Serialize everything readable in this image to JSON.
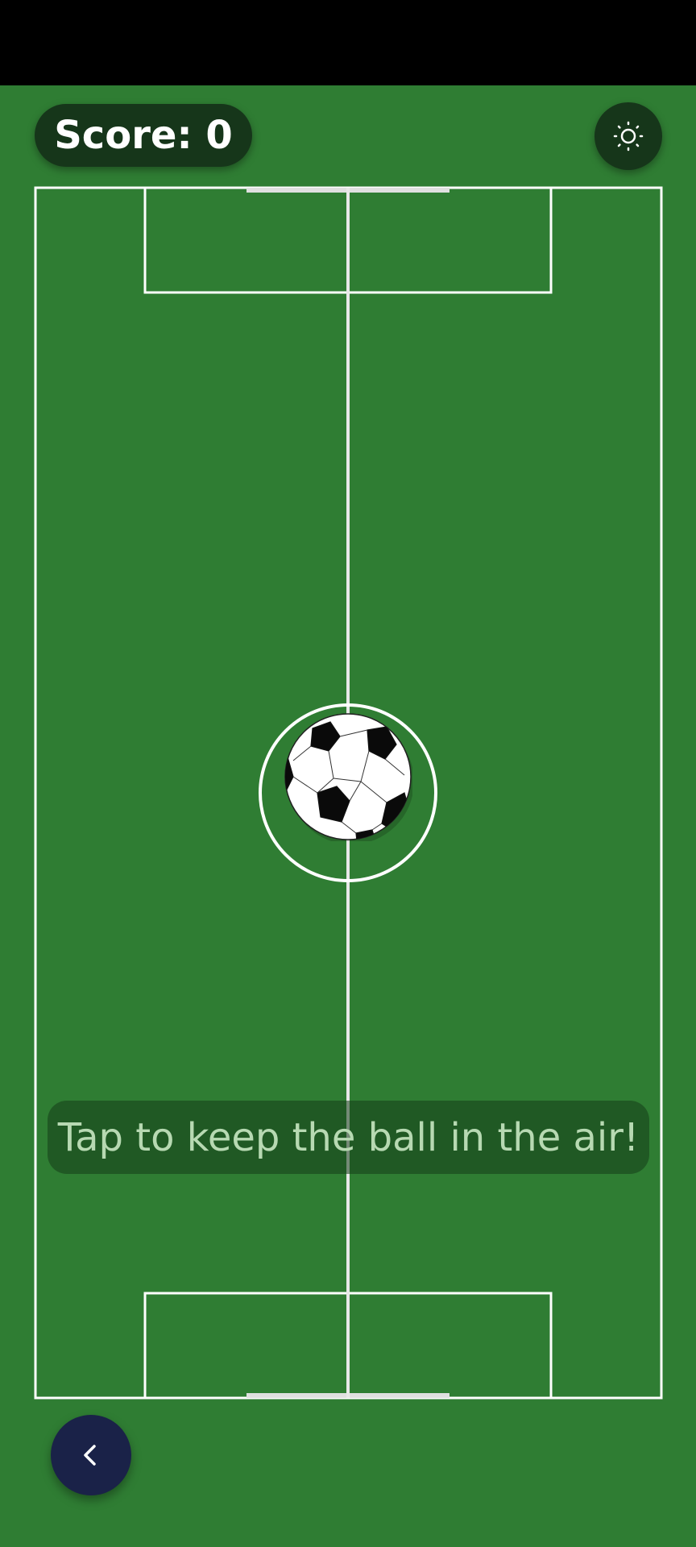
{
  "score": {
    "label": "Score: 0",
    "value": 0
  },
  "hint": {
    "text": "Tap to keep the ball in the air!"
  },
  "controls": {
    "theme_icon": "sun-icon",
    "back_icon": "chevron-left-icon"
  },
  "colors": {
    "field": "#2f7d33",
    "lines": "#ffffff",
    "score_pill": "#16361a",
    "back_button": "#1a2248",
    "hint_text": "#b7d9b2"
  }
}
